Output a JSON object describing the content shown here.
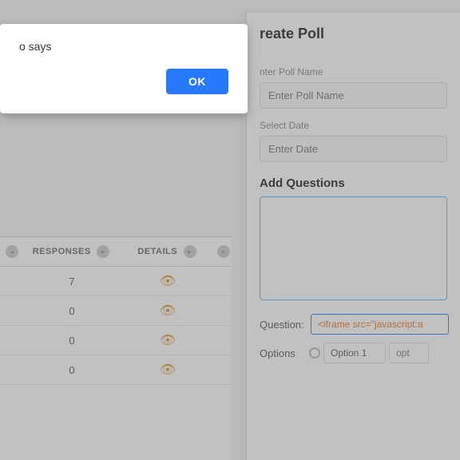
{
  "topbar": {
    "visible": true
  },
  "alert_dialog": {
    "message": "o says",
    "ok_label": "OK"
  },
  "create_poll": {
    "title": "reate Poll",
    "poll_name_label": "nter Poll Name",
    "poll_name_placeholder": "Enter Poll Name",
    "date_label": "Select Date",
    "date_placeholder": "Enter Date",
    "add_questions_label": "Add Questions",
    "question_label": "Question:",
    "question_value": "<iframe src=\"javascript:a",
    "options_label": "Options",
    "option1_value": "Option 1",
    "option2_placeholder": "opt"
  },
  "table": {
    "col_responses": "RESPONSES",
    "col_details": "DETAILS",
    "rows": [
      {
        "responses": "7",
        "has_detail": true
      },
      {
        "responses": "0",
        "has_detail": true
      },
      {
        "responses": "0",
        "has_detail": true
      },
      {
        "responses": "0",
        "has_detail": true
      }
    ]
  }
}
